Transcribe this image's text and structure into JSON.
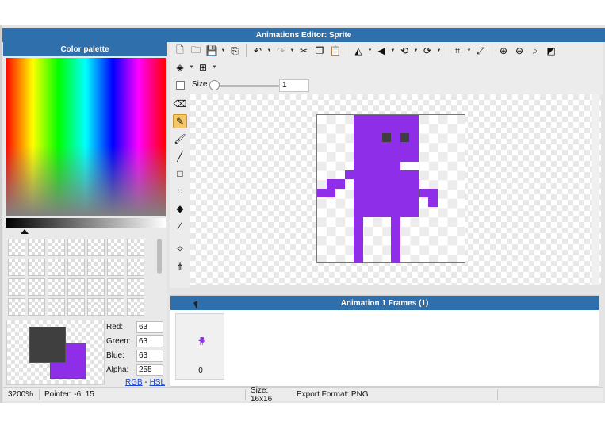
{
  "window": {
    "title": "Animations Editor: Sprite"
  },
  "palette": {
    "title": "Color palette",
    "foreground_color": "#3f3f3f",
    "background_color": "#8f2ee8",
    "fields": [
      {
        "label": "Red:",
        "value": "63"
      },
      {
        "label": "Green:",
        "value": "63"
      },
      {
        "label": "Blue:",
        "value": "63"
      },
      {
        "label": "Alpha:",
        "value": "255"
      }
    ],
    "links": {
      "rgb": "RGB",
      "separator": "-",
      "hsl": "HSL"
    }
  },
  "toolbar": {
    "row1": [
      "new-file-icon",
      "open-folder-icon",
      "save-icon",
      "export-icon",
      "undo-icon",
      "redo-icon",
      "cut-icon",
      "copy-icon",
      "paste-icon",
      "flip-horizontal-icon",
      "flip-vertical-icon",
      "rotate-left-icon",
      "rotate-right-icon",
      "crop-icon",
      "resize-icon",
      "zoom-in-icon",
      "zoom-out-icon",
      "zoom-fit-icon",
      "fill-canvas-icon"
    ],
    "row2": [
      "layers-icon",
      "grid-icon"
    ]
  },
  "size_control": {
    "label": "Size",
    "value": "1"
  },
  "tools": [
    "eraser-icon",
    "pencil-icon",
    "brush-icon",
    "line-icon",
    "rectangle-icon",
    "ellipse-icon",
    "fill-bucket-icon",
    "eyedropper-icon",
    "selection-icon",
    "node-edit-icon"
  ],
  "sprite": {
    "color": "#8f2ee8",
    "eye_color": "#3f3f3f"
  },
  "frames": {
    "title": "Animation 1 Frames (1)",
    "items": [
      {
        "index": "0"
      }
    ]
  },
  "status": {
    "zoom": "3200%",
    "pointer": "Pointer: -6, 15",
    "size": "Size: 16x16",
    "export_format": "Export Format: PNG"
  }
}
